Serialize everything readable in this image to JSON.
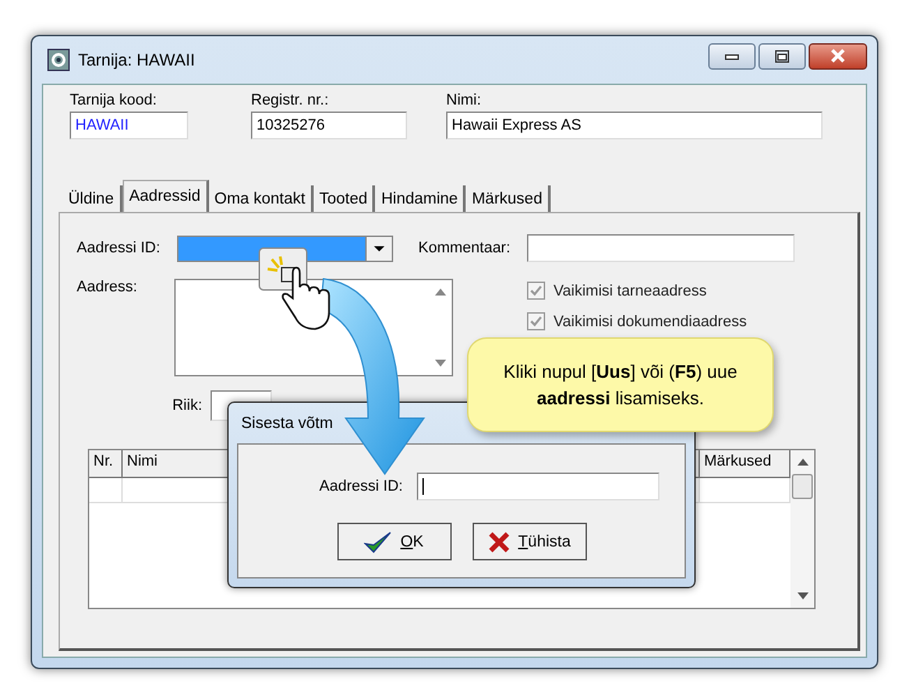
{
  "window": {
    "title": "Tarnija: HAWAII"
  },
  "header_fields": [
    {
      "label": "Tarnija kood:",
      "value": "HAWAII",
      "color": "#1f1fff"
    },
    {
      "label": "Registr. nr.:",
      "value": "10325276",
      "color": "#000000"
    },
    {
      "label": "Nimi:",
      "value": "Hawaii Express AS",
      "color": "#000000"
    }
  ],
  "tabs": [
    {
      "label": "Üldine",
      "selected": false
    },
    {
      "label": "Aadressid",
      "selected": true
    },
    {
      "label": "Oma kontakt",
      "selected": false
    },
    {
      "label": "Tooted",
      "selected": false
    },
    {
      "label": "Hindamine",
      "selected": false
    },
    {
      "label": "Märkused",
      "selected": false
    }
  ],
  "address_tab": {
    "address_id": {
      "label": "Aadressi ID:",
      "focused": true
    },
    "comment": {
      "label": "Kommentaar:"
    },
    "address": {
      "label": "Aadress:"
    },
    "checkboxes": [
      {
        "label": "Vaikimisi tarneaadress",
        "checked": true,
        "disabled": true
      },
      {
        "label": "Vaikimisi dokumendiaadress",
        "checked": true,
        "disabled": true
      }
    ],
    "country": {
      "label": "Riik:"
    },
    "table": {
      "columns": [
        "Nr.",
        "Nimi",
        "Märkused"
      ]
    }
  },
  "dialog": {
    "title": "Sisesta võtm",
    "field_label": "Aadressi ID:",
    "buttons": [
      {
        "label": "OK",
        "kind": "ok",
        "mnemonic": true
      },
      {
        "label": "Tühista",
        "kind": "cancel",
        "mnemonic": true
      }
    ]
  },
  "callout": {
    "text": "Kliki nupul [**Uus**] või (**F5**) uue **aadressi** lisamiseks."
  }
}
